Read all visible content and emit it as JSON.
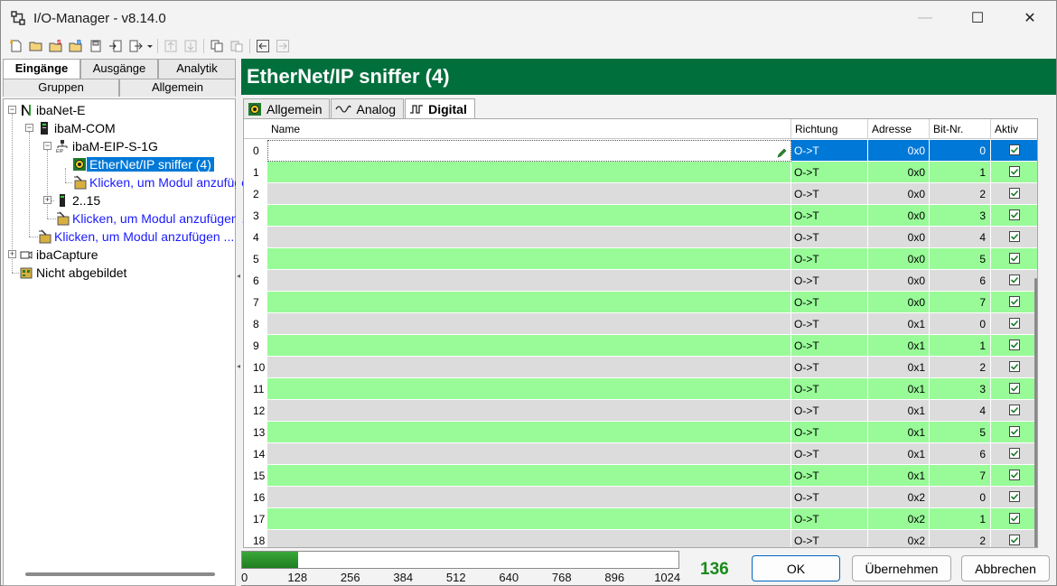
{
  "window": {
    "title": "I/O-Manager - v8.14.0",
    "controls": {
      "minimize": "—",
      "maximize": "☐",
      "close": "✕"
    }
  },
  "toolbar": {
    "icons": [
      "new-icon",
      "open-icon",
      "save-s-icon",
      "save-b-icon",
      "save-disk-icon",
      "import-icon",
      "export-icon",
      "dropdown-arrow-icon",
      "move-up-icon",
      "move-down-icon",
      "copy-icon",
      "paste-icon",
      "nav-left-icon",
      "nav-right-icon"
    ]
  },
  "left_panel": {
    "tabs_top": [
      "Eingänge",
      "Ausgänge",
      "Analytik"
    ],
    "active_tab_top": "Eingänge",
    "tabs_bottom": [
      "Gruppen",
      "Allgemein"
    ],
    "tree": [
      {
        "label": "ibaNet-E"
      },
      {
        "label": "ibaM-COM"
      },
      {
        "label": "ibaM-EIP-S-1G"
      },
      {
        "label": "EtherNet/IP sniffer (4)",
        "selected": true
      },
      {
        "label": "Klicken, um Modul anzufügen ..."
      },
      {
        "label": "2..15"
      },
      {
        "label": "Klicken, um Modul anzufügen ..."
      },
      {
        "label": "Klicken, um Modul anzufügen ..."
      },
      {
        "label": "ibaCapture"
      },
      {
        "label": "Nicht abgebildet"
      }
    ]
  },
  "right_panel": {
    "header_title": "EtherNet/IP sniffer (4)",
    "tabs": [
      "Allgemein",
      "Analog",
      "Digital"
    ],
    "active_tab": "Digital",
    "columns": [
      "Name",
      "Richtung",
      "Adresse",
      "Bit-Nr.",
      "Aktiv"
    ],
    "rows": [
      {
        "idx": "0",
        "name": "",
        "dir": "O->T",
        "addr": "0x0",
        "bit": "0",
        "active": true
      },
      {
        "idx": "1",
        "name": "",
        "dir": "O->T",
        "addr": "0x0",
        "bit": "1",
        "active": true
      },
      {
        "idx": "2",
        "name": "",
        "dir": "O->T",
        "addr": "0x0",
        "bit": "2",
        "active": true
      },
      {
        "idx": "3",
        "name": "",
        "dir": "O->T",
        "addr": "0x0",
        "bit": "3",
        "active": true
      },
      {
        "idx": "4",
        "name": "",
        "dir": "O->T",
        "addr": "0x0",
        "bit": "4",
        "active": true
      },
      {
        "idx": "5",
        "name": "",
        "dir": "O->T",
        "addr": "0x0",
        "bit": "5",
        "active": true
      },
      {
        "idx": "6",
        "name": "",
        "dir": "O->T",
        "addr": "0x0",
        "bit": "6",
        "active": true
      },
      {
        "idx": "7",
        "name": "",
        "dir": "O->T",
        "addr": "0x0",
        "bit": "7",
        "active": true
      },
      {
        "idx": "8",
        "name": "",
        "dir": "O->T",
        "addr": "0x1",
        "bit": "0",
        "active": true
      },
      {
        "idx": "9",
        "name": "",
        "dir": "O->T",
        "addr": "0x1",
        "bit": "1",
        "active": true
      },
      {
        "idx": "10",
        "name": "",
        "dir": "O->T",
        "addr": "0x1",
        "bit": "2",
        "active": true
      },
      {
        "idx": "11",
        "name": "",
        "dir": "O->T",
        "addr": "0x1",
        "bit": "3",
        "active": true
      },
      {
        "idx": "12",
        "name": "",
        "dir": "O->T",
        "addr": "0x1",
        "bit": "4",
        "active": true
      },
      {
        "idx": "13",
        "name": "",
        "dir": "O->T",
        "addr": "0x1",
        "bit": "5",
        "active": true
      },
      {
        "idx": "14",
        "name": "",
        "dir": "O->T",
        "addr": "0x1",
        "bit": "6",
        "active": true
      },
      {
        "idx": "15",
        "name": "",
        "dir": "O->T",
        "addr": "0x1",
        "bit": "7",
        "active": true
      },
      {
        "idx": "16",
        "name": "",
        "dir": "O->T",
        "addr": "0x2",
        "bit": "0",
        "active": true
      },
      {
        "idx": "17",
        "name": "",
        "dir": "O->T",
        "addr": "0x2",
        "bit": "1",
        "active": true
      },
      {
        "idx": "18",
        "name": "",
        "dir": "O->T",
        "addr": "0x2",
        "bit": "2",
        "active": true
      }
    ],
    "selected_row": 0
  },
  "bottom": {
    "gauge_ticks": [
      "0",
      "128",
      "256",
      "384",
      "512",
      "640",
      "768",
      "896",
      "1024"
    ],
    "gauge_max": 1024,
    "gauge_value": 136,
    "count": "136",
    "buttons": {
      "ok": "OK",
      "apply": "Übernehmen",
      "cancel": "Abbrechen"
    }
  },
  "colors": {
    "header_green": "#006f3c",
    "row_green": "#98fb98",
    "row_gray": "#dcdcdc",
    "selection_blue": "#0078d7",
    "link_blue": "#1a1aff",
    "count_green": "#1a8a1a"
  }
}
